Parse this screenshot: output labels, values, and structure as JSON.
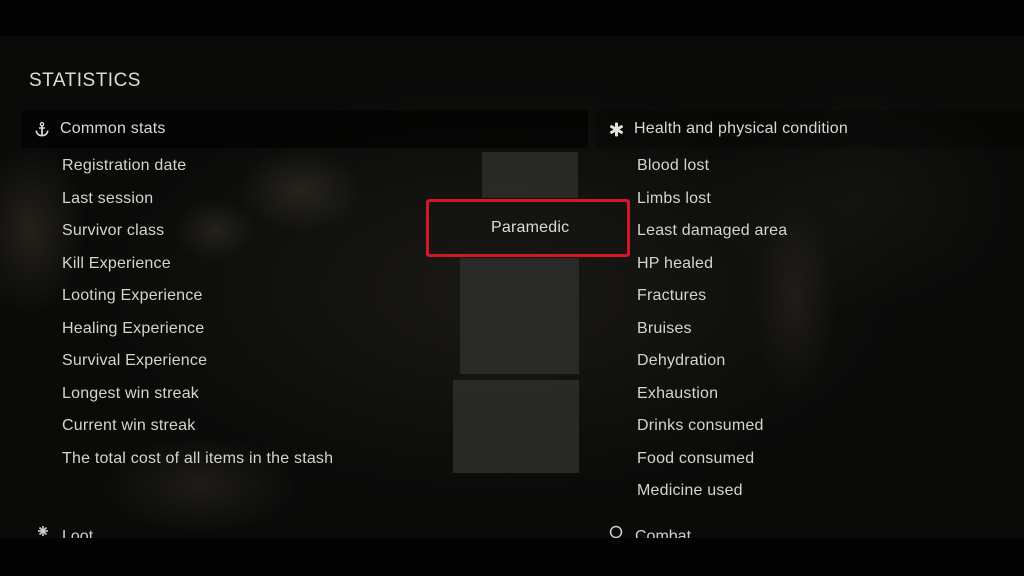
{
  "title": "STATISTICS",
  "common_stats": {
    "header": "Common stats",
    "icon": "anchor-icon",
    "items": [
      "Registration date",
      "Last session",
      "Survivor class",
      "Kill Experience",
      "Looting Experience",
      "Healing Experience",
      "Survival Experience",
      "Longest win streak",
      "Current win streak",
      "The total cost of all items in the stash"
    ]
  },
  "health_stats": {
    "header": "Health and physical condition",
    "icon": "medical-cross-icon",
    "items": [
      "Blood lost",
      "Limbs lost",
      "Least damaged area",
      "HP healed",
      "Fractures",
      "Bruises",
      "Dehydration",
      "Exhaustion",
      "Drinks consumed",
      "Food consumed",
      "Medicine used"
    ]
  },
  "highlight": {
    "value": "Paramedic",
    "border_color": "#d21826"
  },
  "lower_sections": {
    "left_header": "Loot",
    "right_header": "Combat"
  }
}
